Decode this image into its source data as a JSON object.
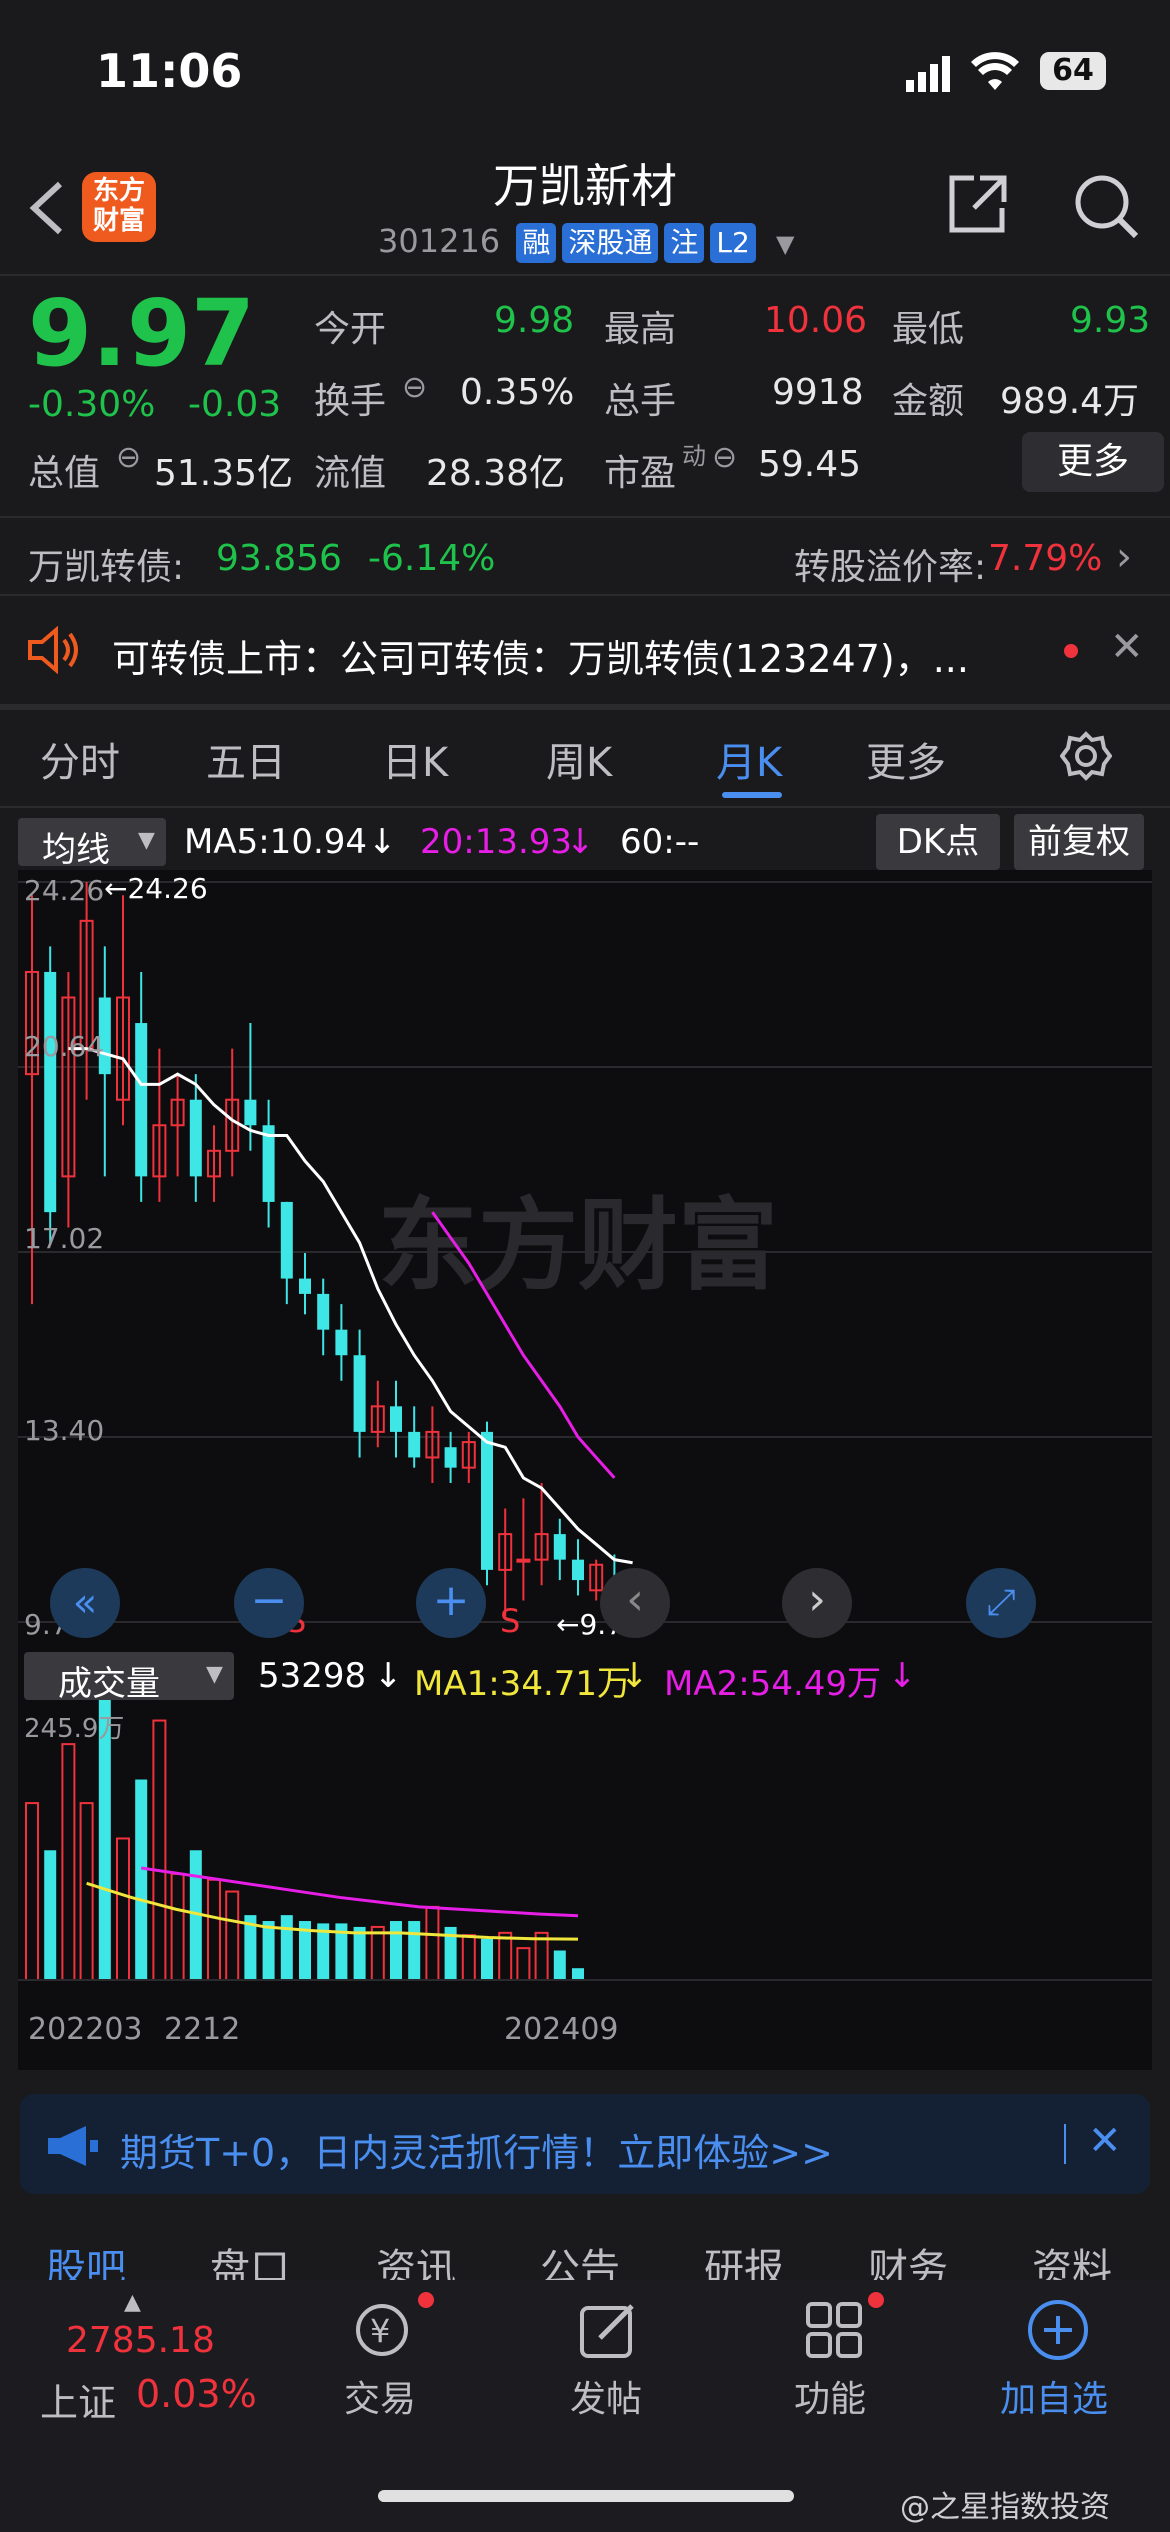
{
  "status": {
    "time": "11:06",
    "battery": "64"
  },
  "header": {
    "title": "万凯新材",
    "logo_text": "东方财富",
    "code": "301216",
    "badges": [
      "融",
      "深股通",
      "注",
      "L2"
    ]
  },
  "quote": {
    "price": "9.97",
    "change_pct": "-0.30%",
    "change": "-0.03",
    "open_label": "今开",
    "open": "9.98",
    "high_label": "最高",
    "high": "10.06",
    "low_label": "最低",
    "low": "9.93",
    "turnover_label": "换手",
    "turnover": "0.35%",
    "volume_label": "总手",
    "volume": "9918",
    "amount_label": "金额",
    "amount": "989.4万",
    "mktcap_label": "总值",
    "mktcap": "51.35亿",
    "float_label": "流值",
    "float": "28.38亿",
    "pe_label": "市盈",
    "pe_sup": "动",
    "pe": "59.45",
    "more_label": "更多"
  },
  "bond": {
    "name": "万凯转债:",
    "price": "93.856",
    "pct": "-6.14%",
    "premium_label": "转股溢价率:",
    "premium": "7.79%"
  },
  "news": {
    "text": "可转债上市：公司可转债：万凯转债(123247)，..."
  },
  "tabs": [
    "分时",
    "五日",
    "日K",
    "周K",
    "月K",
    "更多"
  ],
  "active_tab": "月K",
  "ma": {
    "select_label": "均线",
    "ma5": "MA5:10.94",
    "ma20": "20:13.93",
    "ma60": "60:--",
    "dk_label": "DK点",
    "adjust_label": "前复权"
  },
  "kchart": {
    "y_ticks": [
      "24.26",
      "20.64",
      "17.02",
      "13.40",
      "9.78"
    ],
    "max_label": "24.26",
    "min_label": "9.78",
    "signals": [
      "S",
      "S"
    ],
    "watermark": "东方财富"
  },
  "volume": {
    "select_label": "成交量",
    "value": "53298",
    "ma1": "MA1:34.71万",
    "ma2": "MA2:54.49万",
    "y_top": "245.9万",
    "x_labels": [
      "202203",
      "2212",
      "202409"
    ]
  },
  "chart_data": {
    "type": "candlestick",
    "title": "",
    "candles": [
      {
        "o": 20.5,
        "c": 22.5,
        "h": 24.0,
        "l": 16.0
      },
      {
        "o": 22.5,
        "c": 17.8,
        "h": 23.0,
        "l": 17.2
      },
      {
        "o": 18.5,
        "c": 22.0,
        "h": 22.5,
        "l": 17.5
      },
      {
        "o": 21.0,
        "c": 23.5,
        "h": 24.26,
        "l": 20.0
      },
      {
        "o": 22.0,
        "c": 20.5,
        "h": 23.0,
        "l": 18.5
      },
      {
        "o": 20.0,
        "c": 22.0,
        "h": 24.0,
        "l": 19.5
      },
      {
        "o": 21.5,
        "c": 18.5,
        "h": 22.5,
        "l": 18.0
      },
      {
        "o": 18.5,
        "c": 19.5,
        "h": 21.0,
        "l": 18.0
      },
      {
        "o": 19.5,
        "c": 20.0,
        "h": 20.5,
        "l": 18.5
      },
      {
        "o": 20.0,
        "c": 18.5,
        "h": 20.5,
        "l": 18.0
      },
      {
        "o": 18.5,
        "c": 19.0,
        "h": 19.5,
        "l": 18.0
      },
      {
        "o": 19.0,
        "c": 20.0,
        "h": 21.0,
        "l": 18.5
      },
      {
        "o": 20.0,
        "c": 19.5,
        "h": 21.5,
        "l": 19.0
      },
      {
        "o": 19.5,
        "c": 18.0,
        "h": 20.0,
        "l": 17.5
      },
      {
        "o": 18.0,
        "c": 16.5,
        "h": 18.0,
        "l": 16.0
      },
      {
        "o": 16.5,
        "c": 16.2,
        "h": 17.0,
        "l": 15.8
      },
      {
        "o": 16.2,
        "c": 15.5,
        "h": 16.5,
        "l": 15.0
      },
      {
        "o": 15.5,
        "c": 15.0,
        "h": 16.0,
        "l": 14.5
      },
      {
        "o": 15.0,
        "c": 13.5,
        "h": 15.5,
        "l": 13.0
      },
      {
        "o": 13.5,
        "c": 14.0,
        "h": 14.5,
        "l": 13.2
      },
      {
        "o": 14.0,
        "c": 13.5,
        "h": 14.5,
        "l": 13.0
      },
      {
        "o": 13.5,
        "c": 13.0,
        "h": 14.0,
        "l": 12.8
      },
      {
        "o": 13.0,
        "c": 13.5,
        "h": 14.0,
        "l": 12.5
      },
      {
        "o": 13.2,
        "c": 12.8,
        "h": 13.5,
        "l": 12.5
      },
      {
        "o": 12.8,
        "c": 13.3,
        "h": 13.5,
        "l": 12.5
      },
      {
        "o": 13.5,
        "c": 10.8,
        "h": 13.7,
        "l": 10.5
      },
      {
        "o": 10.8,
        "c": 11.5,
        "h": 12.0,
        "l": 9.9
      },
      {
        "o": 11.0,
        "c": 11.0,
        "h": 12.2,
        "l": 10.2
      },
      {
        "o": 11.0,
        "c": 11.5,
        "h": 12.5,
        "l": 10.5
      },
      {
        "o": 11.5,
        "c": 11.0,
        "h": 11.8,
        "l": 10.6
      },
      {
        "o": 11.0,
        "c": 10.6,
        "h": 11.4,
        "l": 10.3
      },
      {
        "o": 10.4,
        "c": 10.9,
        "h": 11.0,
        "l": 10.2
      },
      {
        "o": 10.6,
        "c": 9.97,
        "h": 11.1,
        "l": 9.78
      },
      {
        "o": 9.98,
        "c": 9.97,
        "h": 10.06,
        "l": 9.93
      }
    ],
    "ma5": [
      21.0,
      21.0,
      20.9,
      20.8,
      20.3,
      20.3,
      20.5,
      20.3,
      19.9,
      19.6,
      19.4,
      19.3,
      19.3,
      18.8,
      18.4,
      17.8,
      17.2,
      16.3,
      15.6,
      15.0,
      14.5,
      13.9,
      13.6,
      13.3,
      13.2,
      12.6,
      12.4,
      12.0,
      11.6,
      11.3,
      11.0,
      10.94
    ],
    "ma20": [
      17.8,
      17.3,
      16.8,
      16.2,
      15.6,
      15.0,
      14.5,
      14.0,
      13.4,
      13.0,
      12.6
    ],
    "volume": [
      150,
      110,
      200,
      150,
      245,
      120,
      170,
      220,
      90,
      110,
      85,
      75,
      55,
      50,
      55,
      50,
      48,
      48,
      45,
      45,
      50,
      50,
      62,
      45,
      38,
      35,
      40,
      27,
      40,
      25,
      10
    ],
    "volume_ma1": [
      82,
      70,
      60,
      52,
      45,
      42,
      40,
      40,
      38,
      36,
      35,
      34.71
    ],
    "volume_ma2": [
      95,
      90,
      85,
      80,
      75,
      70,
      66,
      62,
      60,
      58,
      56,
      54.49
    ],
    "ylim": [
      9.78,
      24.26
    ],
    "volume_ylim": [
      0,
      245.9
    ]
  },
  "notice": {
    "text": "期货T+0，日内灵活抓行情！立即体验>>"
  },
  "bottom_tabs": [
    "股吧",
    "盘口",
    "资讯",
    "公告",
    "研报",
    "财务",
    "资料"
  ],
  "bottom_nav": {
    "index_value": "2785.18",
    "index_name": "上证",
    "index_pct": "0.03%",
    "trade": "交易",
    "post": "发帖",
    "func": "功能",
    "add": "加自选"
  },
  "watermark": "@之星指数投资",
  "colors": {
    "up": "#f0323c",
    "down": "#3ee6e6",
    "accent": "#2a6fd6"
  }
}
